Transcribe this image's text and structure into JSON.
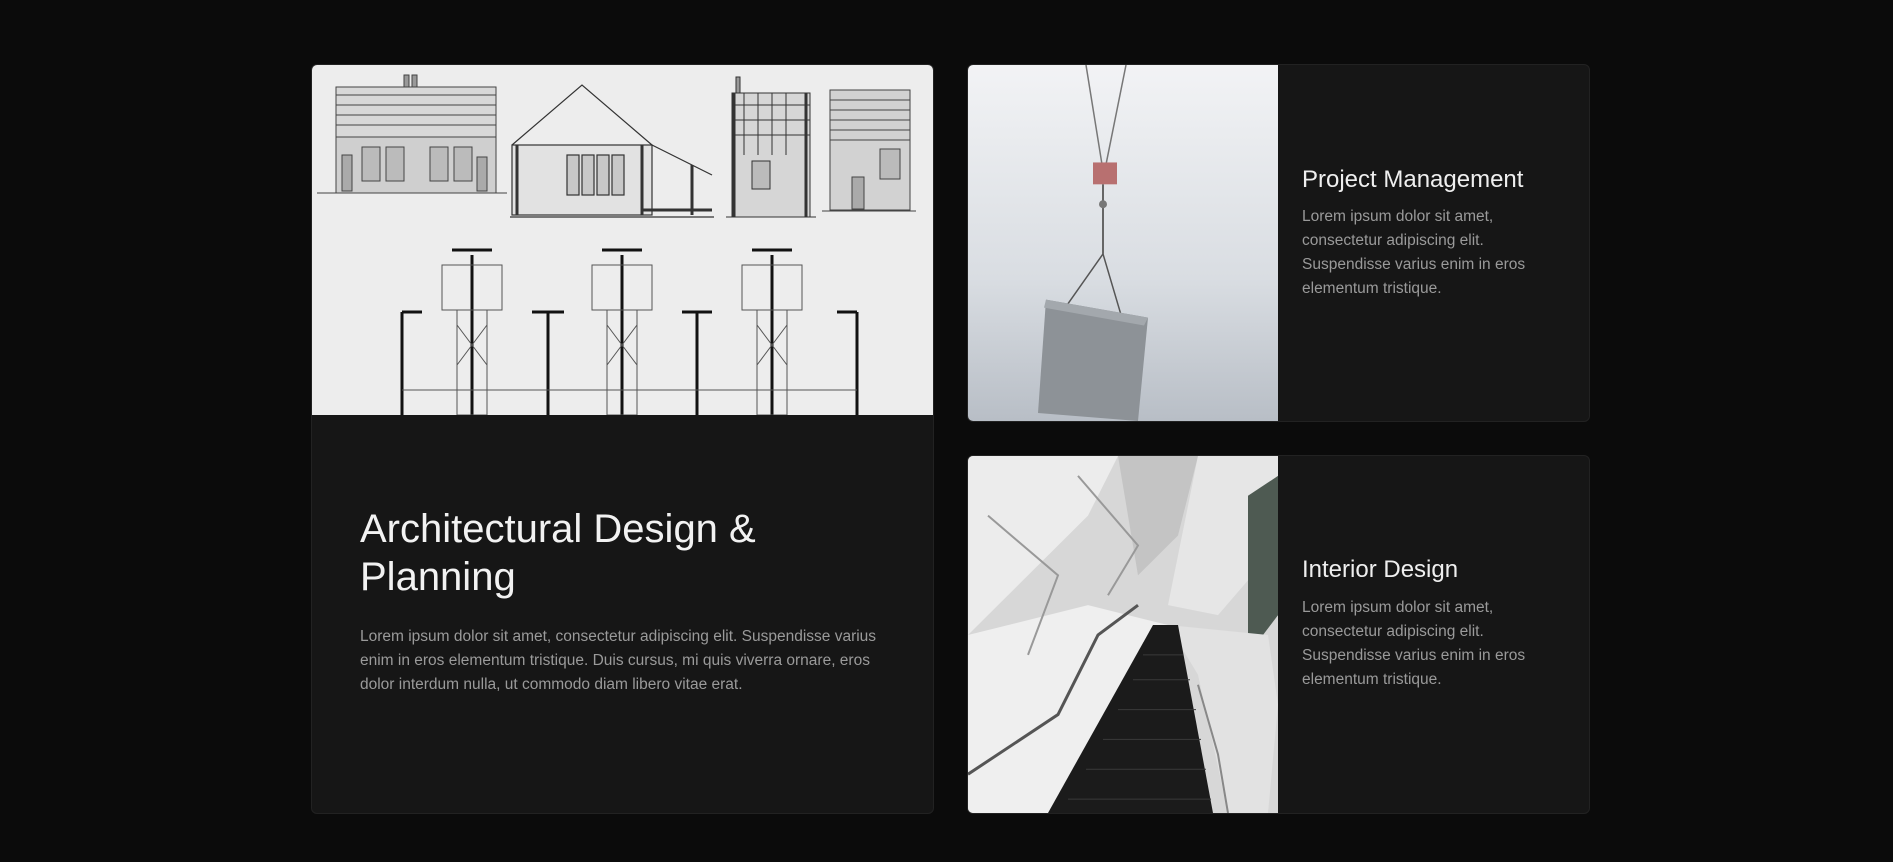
{
  "cards": {
    "main": {
      "title": "Architectural Design & Planning",
      "description": "Lorem ipsum dolor sit amet, consectetur adipiscing elit. Suspendisse varius enim in eros elementum tristique. Duis cursus, mi quis viverra ornare, eros dolor interdum nulla, ut commodo diam libero vitae erat.",
      "image": "architectural-blueprint-image"
    },
    "project_management": {
      "title": "Project Management",
      "description": "Lorem ipsum dolor sit amet, consectetur adipiscing elit. Suspendisse varius enim in eros elementum tristique.",
      "image": "crane-panel-image"
    },
    "interior_design": {
      "title": "Interior Design",
      "description": "Lorem ipsum dolor sit amet, consectetur adipiscing elit. Suspendisse varius enim in eros elementum tristique.",
      "image": "escalator-interior-image"
    }
  },
  "colors": {
    "page_background": "#0b0b0b",
    "card_background": "#161616",
    "heading": "#f2f2f2",
    "body_text": "#9a9a9a"
  }
}
